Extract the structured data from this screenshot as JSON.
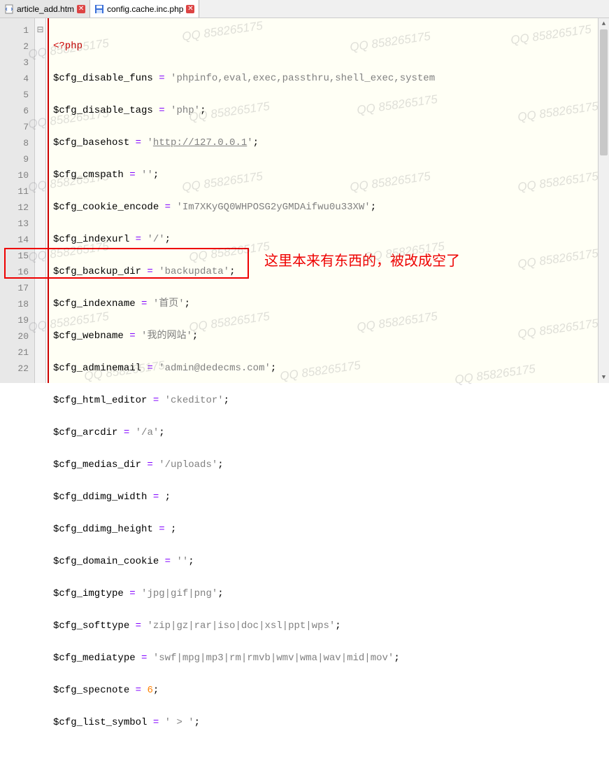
{
  "tabs": [
    {
      "label": "article_add.htm",
      "icon": "file-code-icon",
      "active": false
    },
    {
      "label": "config.cache.inc.php",
      "icon": "save-icon",
      "active": true
    }
  ],
  "lines": {
    "l1": "1",
    "l2": "2",
    "l3": "3",
    "l4": "4",
    "l5": "5",
    "l6": "6",
    "l7": "7",
    "l8": "8",
    "l9": "9",
    "l10": "10",
    "l11": "11",
    "l12": "12",
    "l13": "13",
    "l14": "14",
    "l15": "15",
    "l16": "16",
    "l17": "17",
    "l18": "18",
    "l19": "19",
    "l20": "20",
    "l21": "21",
    "l22": "22"
  },
  "fold_marker": "⊟",
  "code": {
    "php_open": "<?php",
    "v2": "$cfg_disable_funs",
    "s2": "'phpinfo,eval,exec,passthru,shell_exec,system",
    "v3": "$cfg_disable_tags",
    "s3": "'php'",
    "v4": "$cfg_basehost",
    "s4a": "'",
    "s4b": "http://127.0.0.1",
    "s4c": "'",
    "v5": "$cfg_cmspath",
    "s5": "''",
    "v6": "$cfg_cookie_encode",
    "s6": "'Im7XKyGQ0WHPOSG2yGMDAifwu0u33XW'",
    "v7": "$cfg_indexurl",
    "s7": "'/'",
    "v8": "$cfg_backup_dir",
    "s8": "'backupdata'",
    "v9": "$cfg_indexname",
    "s9": "'首页'",
    "v10": "$cfg_webname",
    "s10": "'我的网站'",
    "v11": "$cfg_adminemail",
    "s11": "'admin@dedecms.com'",
    "v12": "$cfg_html_editor",
    "s12": "'ckeditor'",
    "v13": "$cfg_arcdir",
    "s13": "'/a'",
    "v14": "$cfg_medias_dir",
    "s14": "'/uploads'",
    "v15": "$cfg_ddimg_width",
    "v16": "$cfg_ddimg_height",
    "v17": "$cfg_domain_cookie",
    "s17": "''",
    "v18": "$cfg_imgtype",
    "s18": "'jpg|gif|png'",
    "v19": "$cfg_softtype",
    "s19": "'zip|gz|rar|iso|doc|xsl|ppt|wps'",
    "v20": "$cfg_mediatype",
    "s20": "'swf|mpg|mp3|rm|rmvb|wmv|wma|wav|mid|mov'",
    "v21": "$cfg_specnote",
    "n21": "6",
    "v22": "$cfg_list_symbol",
    "s22": "' > '",
    "eq": " = ",
    "semi": ";"
  },
  "annotation": "这里本来有东西的，被改成空了",
  "watermark": "QQ 858265175",
  "scroll": {
    "up": "▲",
    "down": "▼"
  }
}
